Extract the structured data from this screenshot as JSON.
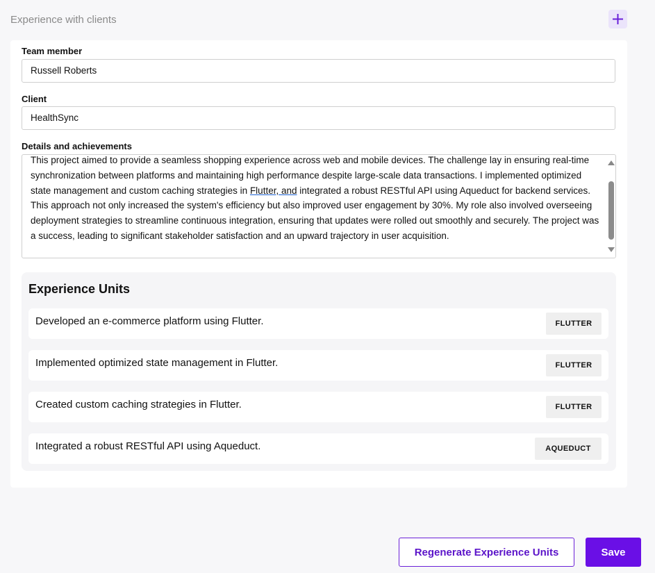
{
  "section": {
    "title": "Experience with clients",
    "add_icon": "plus-icon"
  },
  "form": {
    "team_member": {
      "label": "Team member",
      "value": "Russell Roberts"
    },
    "client": {
      "label": "Client",
      "value": "HealthSync"
    },
    "details": {
      "label": "Details and achievements",
      "text_before": "This project aimed to provide a seamless shopping experience across web and mobile devices. The challenge lay in ensuring real-time synchronization between platforms and maintaining high performance despite large-scale data transactions. I implemented optimized state management and custom caching strategies in ",
      "text_flagged": "Flutter, and",
      "text_after": " integrated a robust RESTful API using Aqueduct for backend services. This approach not only increased the system's efficiency but also improved user engagement by 30%. My role also involved overseeing deployment strategies to streamline continuous integration, ensuring that updates were rolled out smoothly and securely. The project was a success, leading to significant stakeholder satisfaction and an upward trajectory in user acquisition."
    }
  },
  "experience_units": {
    "title": "Experience Units",
    "items": [
      {
        "text": "Developed an e-commerce platform using Flutter.",
        "tag": "FLUTTER"
      },
      {
        "text": "Implemented optimized state management in Flutter.",
        "tag": "FLUTTER"
      },
      {
        "text": "Created custom caching strategies in Flutter.",
        "tag": "FLUTTER"
      },
      {
        "text": "Integrated a robust RESTful API using Aqueduct.",
        "tag": "AQUEDUCT"
      }
    ]
  },
  "actions": {
    "regenerate_label": "Regenerate Experience Units",
    "save_label": "Save"
  },
  "colors": {
    "accent": "#6a0fe6",
    "accent_light": "#ebe4fb",
    "panel_bg": "#f5f5f7",
    "page_bg": "#f7f7f9"
  }
}
